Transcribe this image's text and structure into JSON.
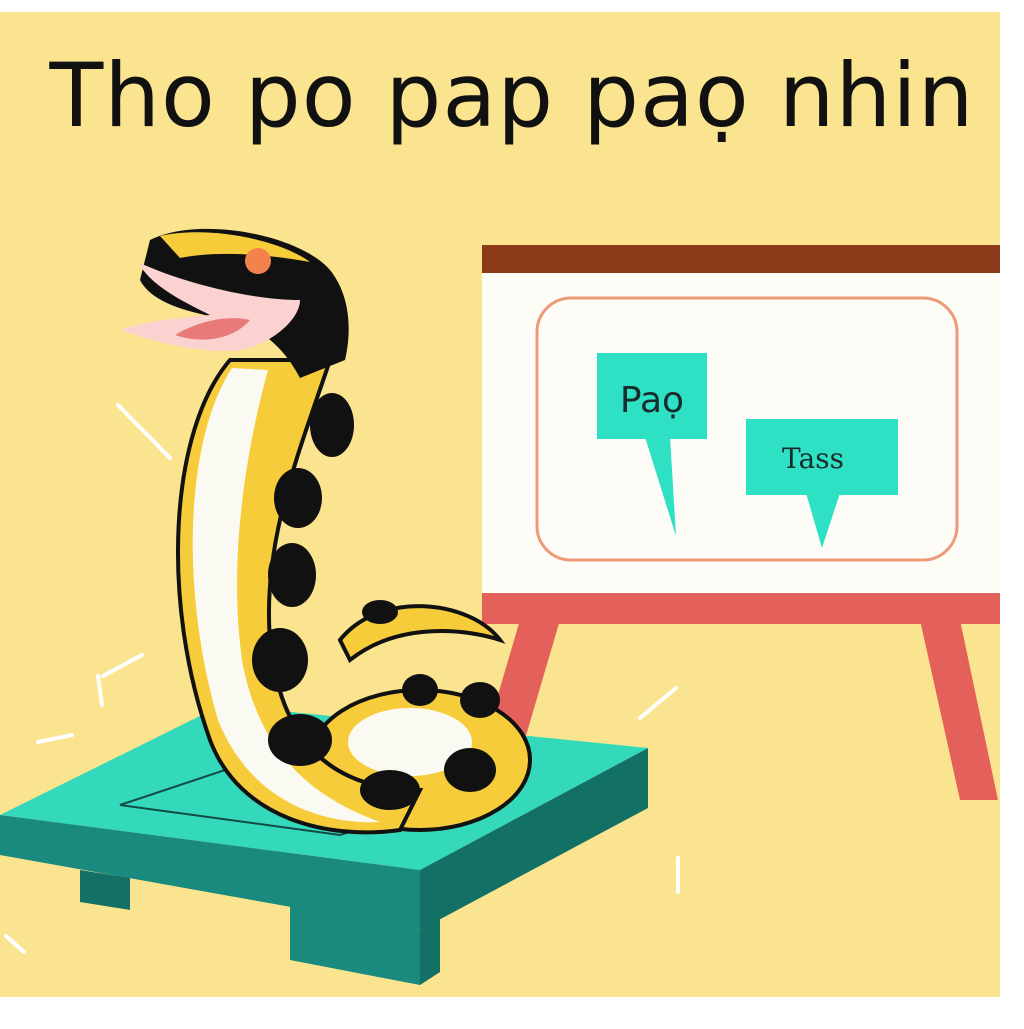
{
  "illustration": {
    "headline": "Tho po pap paọ nhin",
    "board": {
      "bubble_left_label": "Paọ",
      "bubble_right_label": "Tass"
    },
    "colors": {
      "background": "#fbe48f",
      "frame_border": "#ffffff",
      "board_frame": "#8b3a1a",
      "board_panel": "#fdfcf7",
      "board_outline": "#ee9a78",
      "easel_legs": "#e3615a",
      "bubble_fill": "#2ee0c4",
      "platform_top": "#34d9bb",
      "platform_side": "#1a8a7e",
      "snake_yellow": "#f6cc3a",
      "snake_spots": "#111111",
      "snake_belly": "#fbfaf2",
      "snake_mouth": "#e87a7a",
      "snake_eye": "#f4824c"
    },
    "icons": [
      "snake-illustration",
      "whiteboard-easel",
      "speech-bubble",
      "platform"
    ]
  }
}
